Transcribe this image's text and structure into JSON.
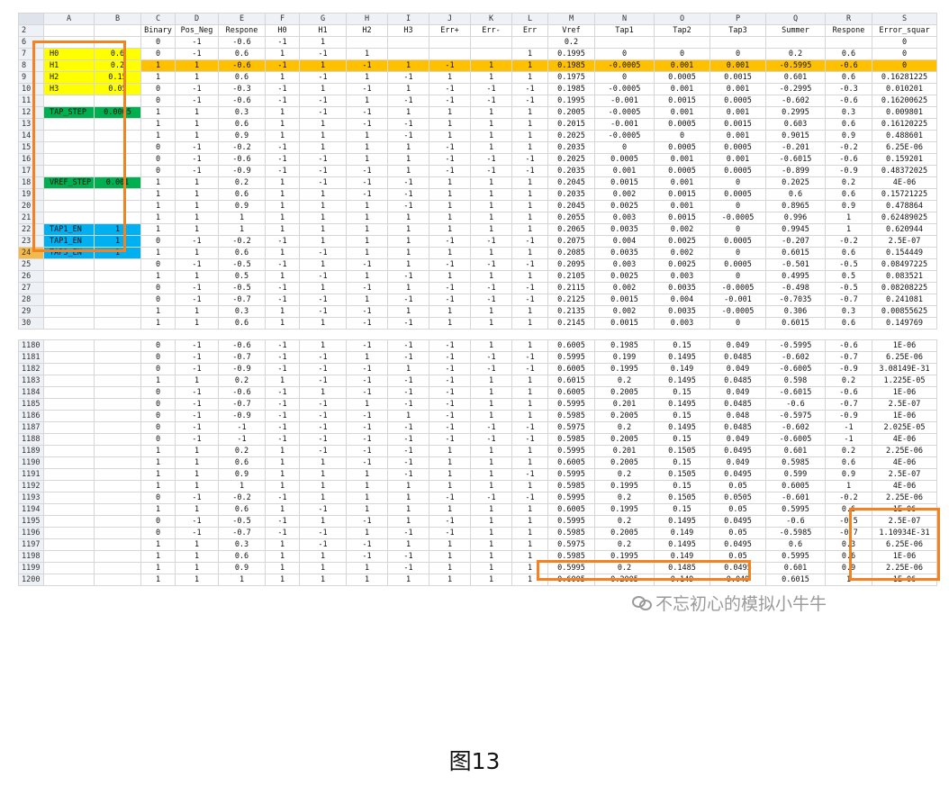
{
  "columns": [
    "",
    "A",
    "B",
    "C",
    "D",
    "E",
    "F",
    "G",
    "H",
    "I",
    "J",
    "K",
    "L",
    "M",
    "N",
    "O",
    "P",
    "Q",
    "R",
    "S"
  ],
  "top_rows": [
    [
      "2",
      "",
      "",
      "Binary",
      "Pos_Neg",
      "Respone",
      "H0",
      "H1",
      "H2",
      "H3",
      "Err+",
      "Err-",
      "Err",
      "Vref",
      "Tap1",
      "Tap2",
      "Tap3",
      "Summer",
      "Respone",
      "Error_squar"
    ],
    [
      "6",
      "",
      "",
      "0",
      "-1",
      "-0.6",
      "-1",
      "1",
      "",
      "",
      "",
      "",
      "",
      "0.2",
      "",
      "",
      "",
      "",
      "",
      "0"
    ],
    [
      "7",
      "H0",
      "0.6",
      "0",
      "-1",
      "0.6",
      "1",
      "-1",
      "1",
      "",
      "",
      "",
      "1",
      "0.1995",
      "0",
      "0",
      "0",
      "0.2",
      "0.6",
      "0"
    ],
    [
      "8",
      "H1",
      "0.2",
      "1",
      "1",
      "-0.6",
      "-1",
      "1",
      "-1",
      "1",
      "-1",
      "1",
      "1",
      "0.1985",
      "-0.0005",
      "0.001",
      "0.001",
      "-0.5995",
      "-0.6",
      "0"
    ],
    [
      "9",
      "H2",
      "0.15",
      "1",
      "1",
      "0.6",
      "1",
      "-1",
      "1",
      "-1",
      "1",
      "1",
      "1",
      "0.1975",
      "0",
      "0.0005",
      "0.0015",
      "0.601",
      "0.6",
      "0.16281225"
    ],
    [
      "10",
      "H3",
      "0.05",
      "0",
      "-1",
      "-0.3",
      "-1",
      "1",
      "-1",
      "1",
      "-1",
      "-1",
      "-1",
      "0.1985",
      "-0.0005",
      "0.001",
      "0.001",
      "-0.2995",
      "-0.3",
      "0.010201"
    ],
    [
      "11",
      "",
      "",
      "0",
      "-1",
      "-0.6",
      "-1",
      "-1",
      "1",
      "-1",
      "-1",
      "-1",
      "-1",
      "0.1995",
      "-0.001",
      "0.0015",
      "0.0005",
      "-0.602",
      "-0.6",
      "0.16200625"
    ],
    [
      "12",
      "TAP_STEP",
      "0.0005",
      "1",
      "1",
      "0.3",
      "1",
      "-1",
      "-1",
      "1",
      "1",
      "1",
      "1",
      "0.2005",
      "-0.0005",
      "0.001",
      "0.001",
      "0.2995",
      "0.3",
      "0.009801"
    ],
    [
      "13",
      "",
      "",
      "1",
      "1",
      "0.6",
      "1",
      "1",
      "-1",
      "-1",
      "1",
      "1",
      "1",
      "0.2015",
      "-0.001",
      "0.0005",
      "0.0015",
      "0.603",
      "0.6",
      "0.16120225"
    ],
    [
      "14",
      "",
      "",
      "1",
      "1",
      "0.9",
      "1",
      "1",
      "1",
      "-1",
      "1",
      "1",
      "1",
      "0.2025",
      "-0.0005",
      "0",
      "0.001",
      "0.9015",
      "0.9",
      "0.488601"
    ],
    [
      "15",
      "",
      "",
      "0",
      "-1",
      "-0.2",
      "-1",
      "1",
      "1",
      "1",
      "-1",
      "1",
      "1",
      "0.2035",
      "0",
      "0.0005",
      "0.0005",
      "-0.201",
      "-0.2",
      "6.25E-06"
    ],
    [
      "16",
      "",
      "",
      "0",
      "-1",
      "-0.6",
      "-1",
      "-1",
      "1",
      "1",
      "-1",
      "-1",
      "-1",
      "0.2025",
      "0.0005",
      "0.001",
      "0.001",
      "-0.6015",
      "-0.6",
      "0.159201"
    ],
    [
      "17",
      "",
      "",
      "0",
      "-1",
      "-0.9",
      "-1",
      "-1",
      "-1",
      "1",
      "-1",
      "-1",
      "-1",
      "0.2035",
      "0.001",
      "0.0005",
      "0.0005",
      "-0.899",
      "-0.9",
      "0.48372025"
    ],
    [
      "18",
      "VREF_STEP",
      "0.001",
      "1",
      "1",
      "0.2",
      "1",
      "-1",
      "-1",
      "-1",
      "1",
      "1",
      "1",
      "0.2045",
      "0.0015",
      "0.001",
      "0",
      "0.2025",
      "0.2",
      "4E-06"
    ],
    [
      "19",
      "",
      "",
      "1",
      "1",
      "0.6",
      "1",
      "1",
      "-1",
      "-1",
      "1",
      "1",
      "1",
      "0.2035",
      "0.002",
      "0.0015",
      "0.0005",
      "0.6",
      "0.6",
      "0.15721225"
    ],
    [
      "20",
      "",
      "",
      "1",
      "1",
      "0.9",
      "1",
      "1",
      "1",
      "-1",
      "1",
      "1",
      "1",
      "0.2045",
      "0.0025",
      "0.001",
      "0",
      "0.8965",
      "0.9",
      "0.478864"
    ],
    [
      "21",
      "",
      "",
      "1",
      "1",
      "1",
      "1",
      "1",
      "1",
      "1",
      "1",
      "1",
      "1",
      "0.2055",
      "0.003",
      "0.0015",
      "-0.0005",
      "0.996",
      "1",
      "0.62489025"
    ],
    [
      "22",
      "TAP1_EN",
      "1",
      "1",
      "1",
      "1",
      "1",
      "1",
      "1",
      "1",
      "1",
      "1",
      "1",
      "0.2065",
      "0.0035",
      "0.002",
      "0",
      "0.9945",
      "1",
      "0.620944"
    ],
    [
      "23",
      "TAP1_EN",
      "1",
      "0",
      "-1",
      "-0.2",
      "-1",
      "1",
      "1",
      "1",
      "-1",
      "-1",
      "-1",
      "0.2075",
      "0.004",
      "0.0025",
      "0.0005",
      "-0.207",
      "-0.2",
      "2.5E-07"
    ],
    [
      "24",
      "TAP3_EN",
      "1",
      "1",
      "1",
      "0.6",
      "1",
      "-1",
      "1",
      "1",
      "1",
      "1",
      "1",
      "0.2085",
      "0.0035",
      "0.002",
      "0",
      "0.6015",
      "0.6",
      "0.154449"
    ],
    [
      "25",
      "",
      "",
      "0",
      "-1",
      "-0.5",
      "-1",
      "1",
      "-1",
      "1",
      "-1",
      "-1",
      "-1",
      "0.2095",
      "0.003",
      "0.0025",
      "0.0005",
      "-0.501",
      "-0.5",
      "0.08497225"
    ],
    [
      "26",
      "",
      "",
      "1",
      "1",
      "0.5",
      "1",
      "-1",
      "1",
      "-1",
      "1",
      "1",
      "1",
      "0.2105",
      "0.0025",
      "0.003",
      "0",
      "0.4995",
      "0.5",
      "0.083521"
    ],
    [
      "27",
      "",
      "",
      "0",
      "-1",
      "-0.5",
      "-1",
      "1",
      "-1",
      "1",
      "-1",
      "-1",
      "-1",
      "0.2115",
      "0.002",
      "0.0035",
      "-0.0005",
      "-0.498",
      "-0.5",
      "0.08208225"
    ],
    [
      "28",
      "",
      "",
      "0",
      "-1",
      "-0.7",
      "-1",
      "-1",
      "1",
      "-1",
      "-1",
      "-1",
      "-1",
      "0.2125",
      "0.0015",
      "0.004",
      "-0.001",
      "-0.7035",
      "-0.7",
      "0.241081"
    ],
    [
      "29",
      "",
      "",
      "1",
      "1",
      "0.3",
      "1",
      "-1",
      "-1",
      "1",
      "1",
      "1",
      "1",
      "0.2135",
      "0.002",
      "0.0035",
      "-0.0005",
      "0.306",
      "0.3",
      "0.00855625"
    ],
    [
      "30",
      "",
      "",
      "1",
      "1",
      "0.6",
      "1",
      "1",
      "-1",
      "-1",
      "1",
      "1",
      "1",
      "0.2145",
      "0.0015",
      "0.003",
      "0",
      "0.6015",
      "0.6",
      "0.149769"
    ]
  ],
  "bottom_rows": [
    [
      "1180",
      "",
      "",
      "0",
      "-1",
      "-0.6",
      "-1",
      "1",
      "-1",
      "-1",
      "-1",
      "1",
      "1",
      "0.6005",
      "0.1985",
      "0.15",
      "0.049",
      "-0.5995",
      "-0.6",
      "1E-06"
    ],
    [
      "1181",
      "",
      "",
      "0",
      "-1",
      "-0.7",
      "-1",
      "-1",
      "1",
      "-1",
      "-1",
      "-1",
      "-1",
      "0.5995",
      "0.199",
      "0.1495",
      "0.0485",
      "-0.602",
      "-0.7",
      "6.25E-06"
    ],
    [
      "1182",
      "",
      "",
      "0",
      "-1",
      "-0.9",
      "-1",
      "-1",
      "-1",
      "1",
      "-1",
      "-1",
      "-1",
      "0.6005",
      "0.1995",
      "0.149",
      "0.049",
      "-0.6005",
      "-0.9",
      "3.08149E-31"
    ],
    [
      "1183",
      "",
      "",
      "1",
      "1",
      "0.2",
      "1",
      "-1",
      "-1",
      "-1",
      "-1",
      "1",
      "1",
      "0.6015",
      "0.2",
      "0.1495",
      "0.0485",
      "0.598",
      "0.2",
      "1.225E-05"
    ],
    [
      "1184",
      "",
      "",
      "0",
      "-1",
      "-0.6",
      "-1",
      "1",
      "-1",
      "-1",
      "-1",
      "1",
      "1",
      "0.6005",
      "0.2005",
      "0.15",
      "0.049",
      "-0.6015",
      "-0.6",
      "1E-06"
    ],
    [
      "1185",
      "",
      "",
      "0",
      "-1",
      "-0.7",
      "-1",
      "-1",
      "1",
      "-1",
      "-1",
      "1",
      "1",
      "0.5995",
      "0.201",
      "0.1495",
      "0.0485",
      "-0.6",
      "-0.7",
      "2.5E-07"
    ],
    [
      "1186",
      "",
      "",
      "0",
      "-1",
      "-0.9",
      "-1",
      "-1",
      "-1",
      "1",
      "-1",
      "1",
      "1",
      "0.5985",
      "0.2005",
      "0.15",
      "0.048",
      "-0.5975",
      "-0.9",
      "1E-06"
    ],
    [
      "1187",
      "",
      "",
      "0",
      "-1",
      "-1",
      "-1",
      "-1",
      "-1",
      "-1",
      "-1",
      "-1",
      "-1",
      "0.5975",
      "0.2",
      "0.1495",
      "0.0485",
      "-0.602",
      "-1",
      "2.025E-05"
    ],
    [
      "1188",
      "",
      "",
      "0",
      "-1",
      "-1",
      "-1",
      "-1",
      "-1",
      "-1",
      "-1",
      "-1",
      "-1",
      "0.5985",
      "0.2005",
      "0.15",
      "0.049",
      "-0.6005",
      "-1",
      "4E-06"
    ],
    [
      "1189",
      "",
      "",
      "1",
      "1",
      "0.2",
      "1",
      "-1",
      "-1",
      "-1",
      "1",
      "1",
      "1",
      "0.5995",
      "0.201",
      "0.1505",
      "0.0495",
      "0.601",
      "0.2",
      "2.25E-06"
    ],
    [
      "1190",
      "",
      "",
      "1",
      "1",
      "0.6",
      "1",
      "1",
      "-1",
      "-1",
      "1",
      "1",
      "1",
      "0.6005",
      "0.2005",
      "0.15",
      "0.049",
      "0.5985",
      "0.6",
      "4E-06"
    ],
    [
      "1191",
      "",
      "",
      "1",
      "1",
      "0.9",
      "1",
      "1",
      "1",
      "-1",
      "1",
      "1",
      "-1",
      "0.5995",
      "0.2",
      "0.1505",
      "0.0495",
      "0.599",
      "0.9",
      "2.5E-07"
    ],
    [
      "1192",
      "",
      "",
      "1",
      "1",
      "1",
      "1",
      "1",
      "1",
      "1",
      "1",
      "1",
      "1",
      "0.5985",
      "0.1995",
      "0.15",
      "0.05",
      "0.6005",
      "1",
      "4E-06"
    ],
    [
      "1193",
      "",
      "",
      "0",
      "-1",
      "-0.2",
      "-1",
      "1",
      "1",
      "1",
      "-1",
      "-1",
      "-1",
      "0.5995",
      "0.2",
      "0.1505",
      "0.0505",
      "-0.601",
      "-0.2",
      "2.25E-06"
    ],
    [
      "1194",
      "",
      "",
      "1",
      "1",
      "0.6",
      "1",
      "-1",
      "1",
      "1",
      "1",
      "1",
      "1",
      "0.6005",
      "0.1995",
      "0.15",
      "0.05",
      "0.5995",
      "0.6",
      "1E-06"
    ],
    [
      "1195",
      "",
      "",
      "0",
      "-1",
      "-0.5",
      "-1",
      "1",
      "-1",
      "1",
      "-1",
      "1",
      "1",
      "0.5995",
      "0.2",
      "0.1495",
      "0.0495",
      "-0.6",
      "-0.5",
      "2.5E-07"
    ],
    [
      "1196",
      "",
      "",
      "0",
      "-1",
      "-0.7",
      "-1",
      "-1",
      "1",
      "-1",
      "-1",
      "1",
      "1",
      "0.5985",
      "0.2005",
      "0.149",
      "0.05",
      "-0.5985",
      "-0.7",
      "1.10934E-31"
    ],
    [
      "1197",
      "",
      "",
      "1",
      "1",
      "0.3",
      "1",
      "-1",
      "-1",
      "1",
      "1",
      "1",
      "1",
      "0.5975",
      "0.2",
      "0.1495",
      "0.0495",
      "0.6",
      "0.3",
      "6.25E-06"
    ],
    [
      "1198",
      "",
      "",
      "1",
      "1",
      "0.6",
      "1",
      "1",
      "-1",
      "-1",
      "1",
      "1",
      "1",
      "0.5985",
      "0.1995",
      "0.149",
      "0.05",
      "0.5995",
      "0.6",
      "1E-06"
    ],
    [
      "1199",
      "",
      "",
      "1",
      "1",
      "0.9",
      "1",
      "1",
      "1",
      "-1",
      "1",
      "1",
      "1",
      "0.5995",
      "0.2",
      "0.1485",
      "0.0495",
      "0.601",
      "0.9",
      "2.25E-06"
    ],
    [
      "1200",
      "",
      "",
      "1",
      "1",
      "1",
      "1",
      "1",
      "1",
      "1",
      "1",
      "1",
      "1",
      "0.6005",
      "0.2005",
      "0.149",
      "0.049",
      "0.6015",
      "1",
      "1E-06"
    ]
  ],
  "highlight_row": "8",
  "label_colors": {
    "yellow": "#ffff00",
    "green": "#00b050",
    "blue": "#00b0f0",
    "row_highlight": "#ffc000",
    "frame": "#f58220"
  },
  "watermark": "不忘初心的模拟小牛牛",
  "watermark_icon": "wechat-icon",
  "caption": "图13"
}
